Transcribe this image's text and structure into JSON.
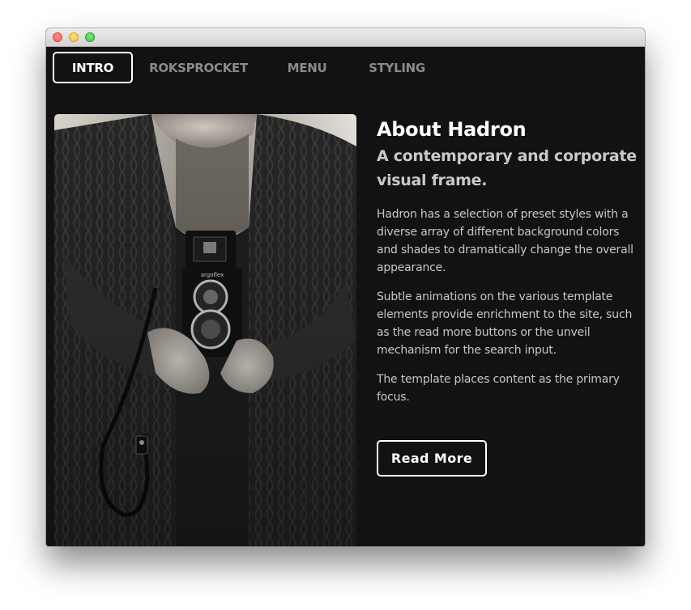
{
  "window": {
    "controls": [
      "close",
      "minimize",
      "zoom"
    ]
  },
  "nav": {
    "items": [
      {
        "label": "INTRO",
        "active": true
      },
      {
        "label": "ROKSPROCKET",
        "active": false
      },
      {
        "label": "MENU",
        "active": false
      },
      {
        "label": "STYLING",
        "active": false
      }
    ]
  },
  "hero_image": {
    "icon": "photo-man-with-camera",
    "camera_brand": "argoflex"
  },
  "content": {
    "title": "About Hadron",
    "subtitle": "A contemporary and corporate visual frame.",
    "paragraphs": [
      "Hadron has a selection of preset styles with a diverse array of different background colors and shades to dramatically change the overall appearance.",
      "Subtle animations on the various template elements provide enrichment to the site, such as the read more buttons or the unveil mechanism for the search input.",
      "The template places content as the primary focus."
    ],
    "button_label": "Read More"
  },
  "colors": {
    "background": "#121214",
    "text_primary": "#ffffff",
    "text_secondary": "#c6c6c8",
    "nav_inactive": "#8a8a8c"
  }
}
